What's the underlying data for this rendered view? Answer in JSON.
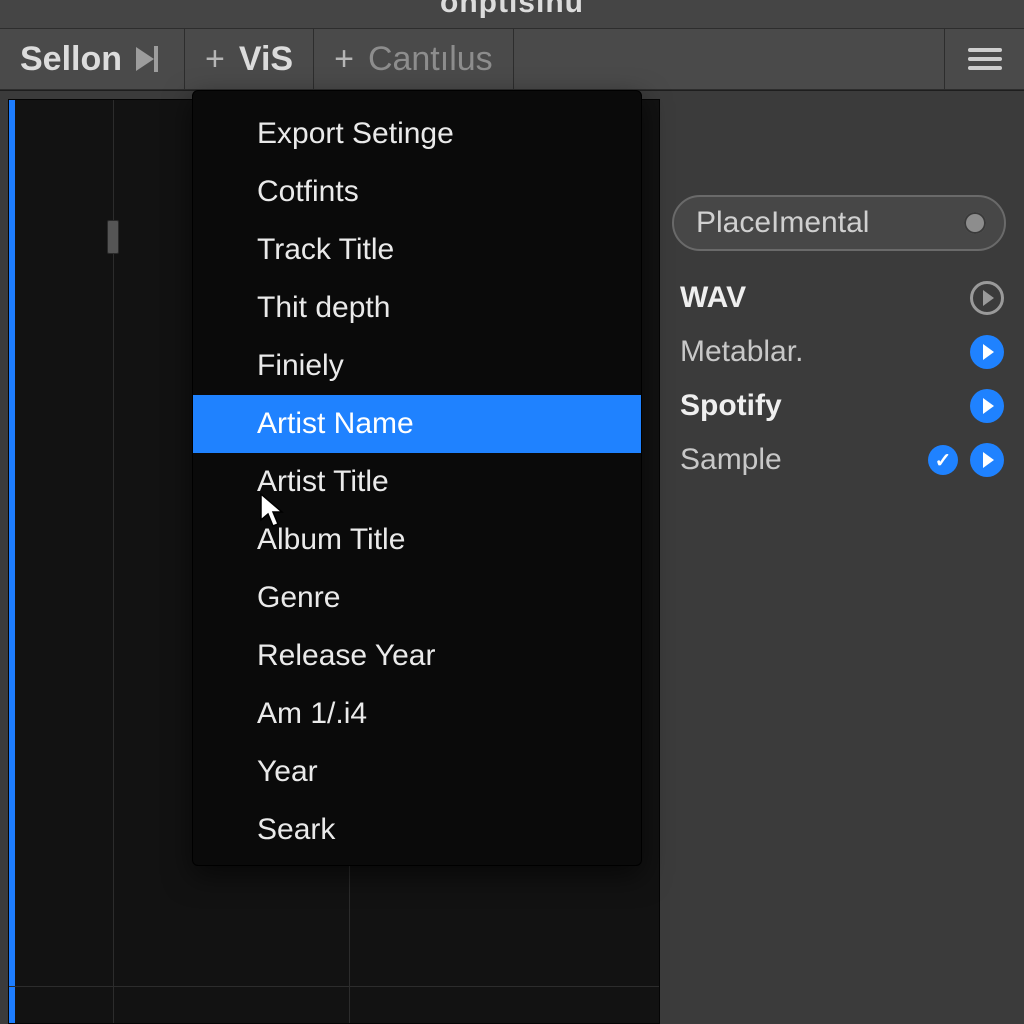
{
  "app_title_fragment": "onptisınu",
  "toolbar": {
    "tab1": "Sellon",
    "tab2": "ViS",
    "tab3": "Cantılus"
  },
  "dropdown": {
    "items": [
      "Export Setinge",
      "Cotfints",
      "Track Title",
      "Thit depth",
      "Finiely",
      "Artist Name",
      "Artist Title",
      "Album Title",
      "Genre",
      "Release Year",
      "Am 1/.i4",
      "Year",
      "Seark"
    ],
    "selected_index": 5
  },
  "side": {
    "search_label": "PlaceImental",
    "rows": [
      {
        "label": "WAV",
        "bold": true,
        "check": false,
        "play": "hollow"
      },
      {
        "label": "Metablar.",
        "bold": false,
        "check": false,
        "play": "solid"
      },
      {
        "label": "Spotify",
        "bold": true,
        "check": false,
        "play": "solid"
      },
      {
        "label": "Sample",
        "bold": false,
        "check": true,
        "play": "solid"
      }
    ]
  },
  "colors": {
    "accent": "#1f82ff"
  }
}
